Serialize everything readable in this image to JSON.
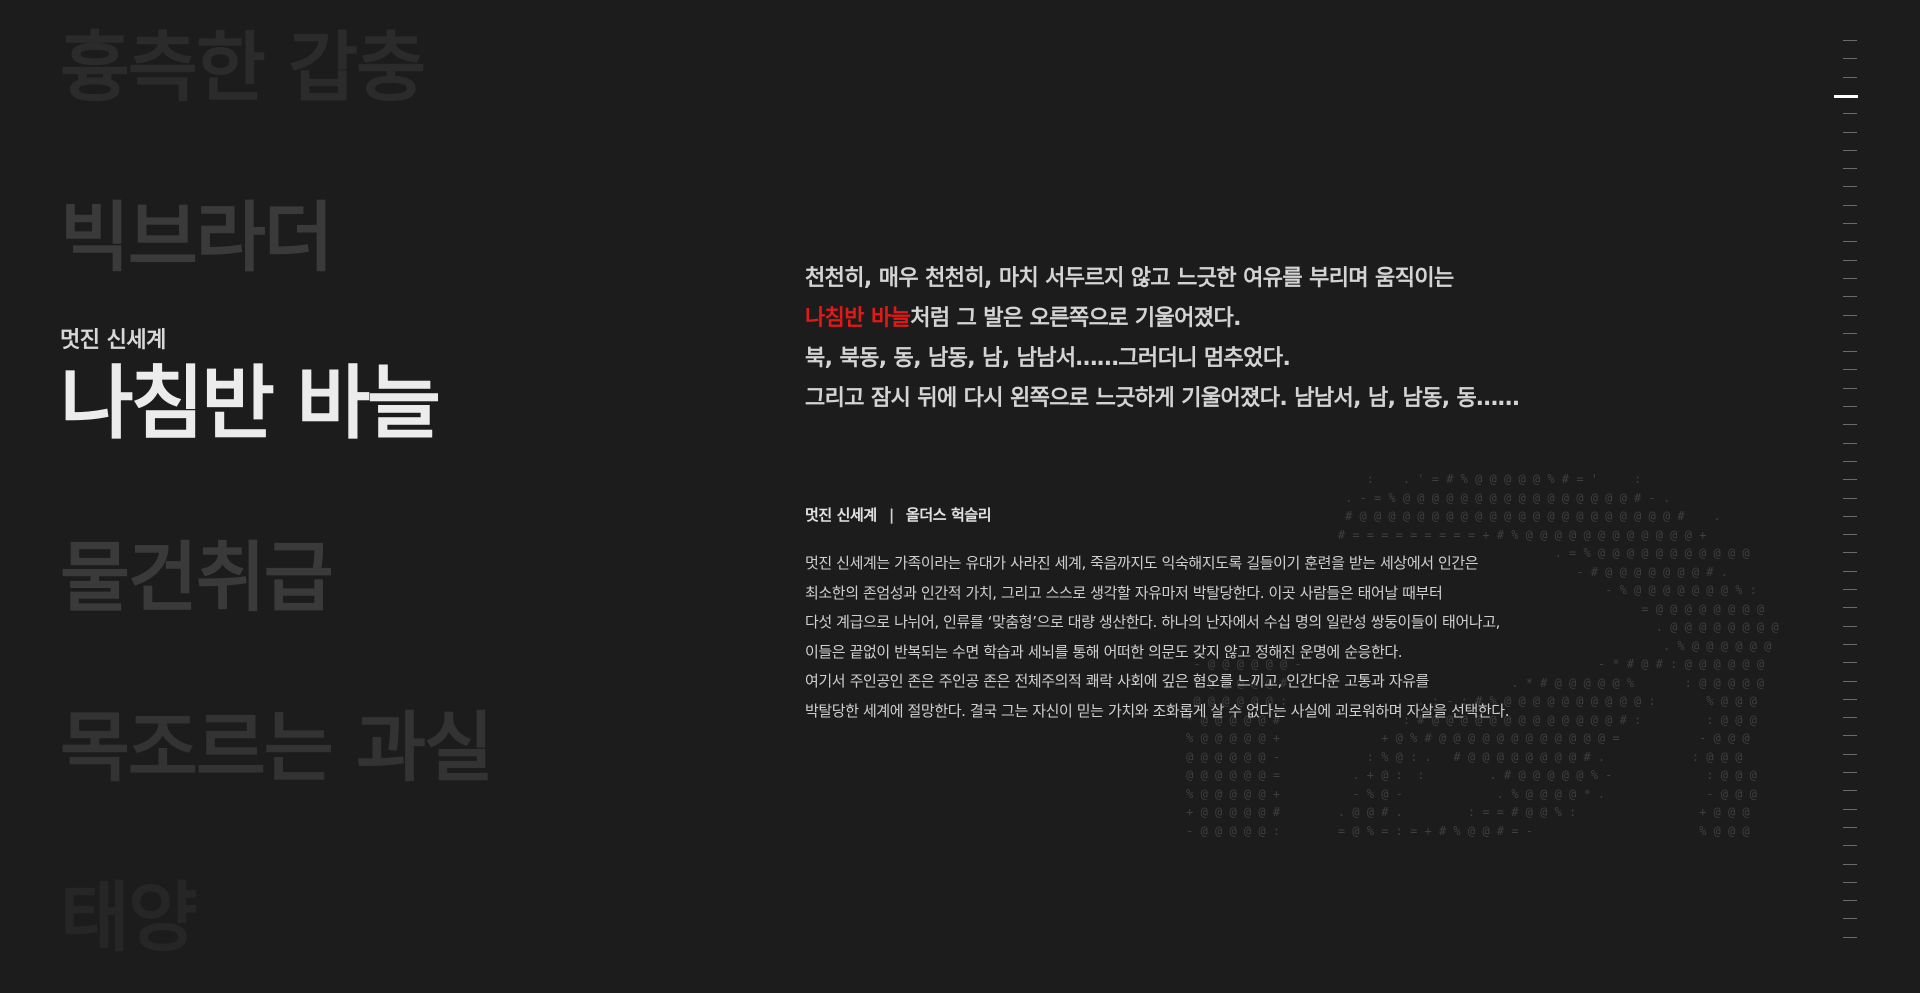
{
  "words": [
    "흉측한 갑충",
    "빅브라더",
    "나침반 바늘",
    "물건취급",
    "목조르는 과실",
    "태양"
  ],
  "active": {
    "book_title": "멋진 신세계",
    "word": "나침반 바늘"
  },
  "quote": {
    "line1": "천천히, 매우 천천히, 마치 서두르지 않고 느긋한 여유를 부리며 움직이는",
    "line2_highlight": "나침반 바늘",
    "line2_rest": "처럼 그 발은 오른쪽으로 기울어졌다.",
    "line3": "북, 북동, 동, 남동, 남, 남남서……그러더니 멈추었다.",
    "line4": "그리고 잠시 뒤에 다시 왼쪽으로 느긋하게 기울어졌다. 남남서, 남, 남동, 동……"
  },
  "book": {
    "title": "멋진 신세계",
    "separator": "|",
    "author": "올더스 헉슬리",
    "description": [
      "멋진 신세계는 가족이라는 유대가 사라진 세계, 죽음까지도 익숙해지도록 길들이기 훈련을 받는 세상에서 인간은",
      "최소한의 존엄성과 인간적 가치, 그리고 스스로 생각할 자유마저 박탈당한다. 이곳 사람들은 태어날 때부터",
      "다섯 계급으로 나뉘어, 인류를 ‘맞춤형’으로 대량 생산한다. 하나의 난자에서 수십 명의 일란성 쌍둥이들이 태어나고,",
      "이들은 끝없이 반복되는 수면 학습과 세뇌를 통해 어떠한 의문도 갖지 않고 정해진 운명에 순응한다.",
      "여기서 주인공인 존은 주인공 존은 전체주의적 쾌락 사회에 깊은 혐오를 느끼고, 인간다운 고통과 자유를",
      "박탈당한 세계에 절망한다. 결국 그는 자신이 믿는 가치와 조화롭게 살 수 없다는 사실에 괴로워하며 자살을 선택한다."
    ]
  },
  "ascii_art": [
    "                              :    . ' = # % @ @ @ @ @ % # = '     :",
    "                           . - = % @ @ @ @ @ @ @ @ @ @ @ @ @ @ @ @ # - .",
    "                           # @ @ @ @ @ @ @ @ @ @ @ @ @ @ @ @ @ @ @ @ @ @ #    .",
    "                          # = = = = = = = = = + # % @ @ @ @ @ @ @ @ @ @ @ @ +",
    "                                                        . = % @ @ @ @ @ @ @ @ @ @ @",
    "                                                           - # @ @ @ @ @ @ @ # .",
    "                                                               - % @ @ @ @ @ @ @ % :",
    "                                                                    = @ @ @ @ @ @ @ @",
    "                                                                      . @ @ @ @ @ @ @ @",
    "                                                                       . % @ @ @ @ @ @",
    "      - @ @ @ @ @ @ -                                         - * # @ # : @ @ @ @ @ @",
    "      % @ @ @ @ @ #                               . * # @ @ @ @ @ %       : @ @ @ @ @",
    "      @ @ @ @ @ @ :                  . : - : # % @ @ @ @ @ @ @ @ @ @ :       % @ @ @",
    "     * @ @ @ @ @ #                 : # @ @ @ @ @ @ @ @ @ @ @ @ @ # :         : @ @ @",
    "     % @ @ @ @ @ +              + @ % # @ @ @ @ @ @ @ @ @ @ @ @ =           - @ @ @",
    "     @ @ @ @ @ @ -            : % @ : .   # @ @ @ @ @ @ @ @ # .            : @ @ @",
    "     @ @ @ @ @ @ =          . + @ :  :         . # @ @ @ @ @ % -             : @ @ @",
    "     % @ @ @ @ @ +          - % @ -             . % @ @ @ @ * .              - @ @ @",
    "     + @ @ @ @ @ #        . @ @ # .         : = = # @ @ % :                 + @ @ @",
    "     - @ @ @ @ @ :        = @ % = : = + # % @ @ # = -                       % @ @ @"
  ],
  "scroll_indicator": {
    "ticks": 50,
    "active_index": 3
  }
}
